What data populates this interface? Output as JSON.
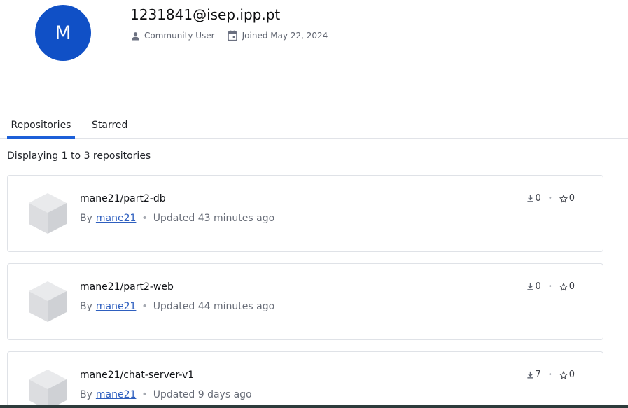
{
  "profile": {
    "avatar_letter": "M",
    "avatar_color": "#1050c6",
    "name": "1231841@isep.ipp.pt",
    "role": "Community User",
    "joined": "Joined May 22, 2024",
    "role_icon": "person-icon",
    "joined_icon": "calendar-icon"
  },
  "tabs": [
    {
      "label": "Repositories",
      "active": true
    },
    {
      "label": "Starred",
      "active": false
    }
  ],
  "repo_count_text": "Displaying 1 to 3 repositories",
  "repositories": [
    {
      "name": "mane21/part2-db",
      "by_label": "By",
      "owner": "mane21",
      "updated": "Updated 43 minutes ago",
      "downloads": "0",
      "stars": "0"
    },
    {
      "name": "mane21/part2-web",
      "by_label": "By",
      "owner": "mane21",
      "updated": "Updated 44 minutes ago",
      "downloads": "0",
      "stars": "0"
    },
    {
      "name": "mane21/chat-server-v1",
      "by_label": "By",
      "owner": "mane21",
      "updated": "Updated 9 days ago",
      "downloads": "7",
      "stars": "0"
    }
  ],
  "colors": {
    "accent": "#1c5fd8",
    "link": "#2e5fbf"
  }
}
